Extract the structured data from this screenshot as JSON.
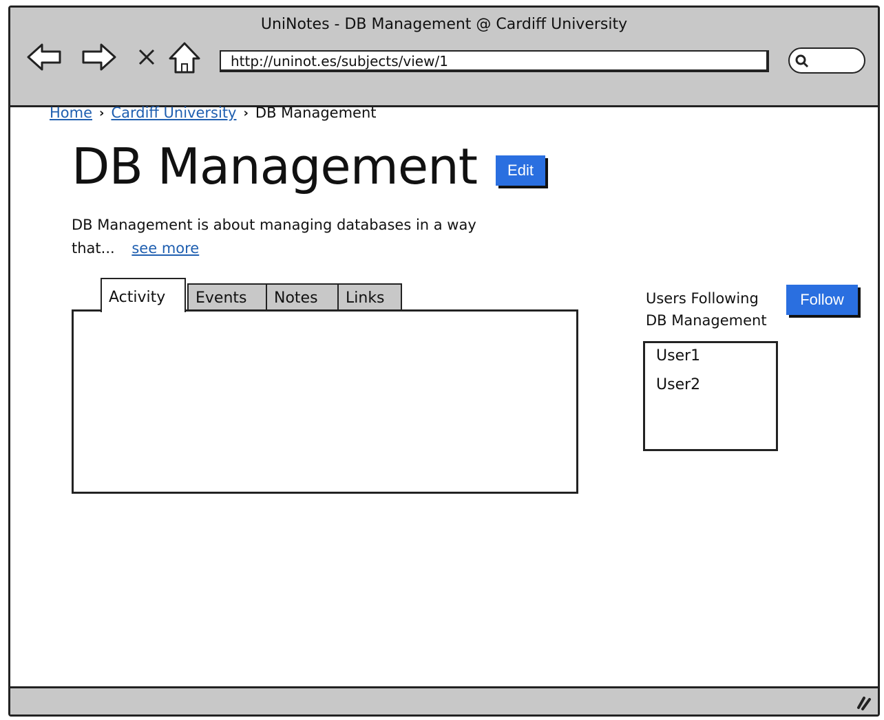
{
  "window": {
    "title": "UniNotes - DB Management @ Cardiff University"
  },
  "browser": {
    "url": "http://uninot.es/subjects/view/1",
    "icons": [
      "back-arrow-icon",
      "forward-arrow-icon",
      "close-icon",
      "home-icon",
      "search-icon"
    ]
  },
  "breadcrumb": [
    {
      "label": "Home",
      "link": true
    },
    {
      "label": "Cardiff University",
      "link": true
    },
    {
      "label": "DB Management",
      "link": false
    }
  ],
  "page": {
    "title": "DB Management",
    "edit_label": "Edit",
    "description": "DB Management is about managing databases in a way that...",
    "see_more": "see more"
  },
  "tabs": [
    {
      "label": "Activity",
      "active": true
    },
    {
      "label": "Events",
      "active": false
    },
    {
      "label": "Notes",
      "active": false
    },
    {
      "label": "Links",
      "active": false
    }
  ],
  "followers": {
    "label_line1": "Users Following",
    "label_line2": "DB Management",
    "follow_label": "Follow",
    "users": [
      "User1",
      "User2"
    ]
  },
  "colors": {
    "accent": "#2a6fe0",
    "link": "#1f5fb0",
    "chrome": "#c8c8c8"
  }
}
